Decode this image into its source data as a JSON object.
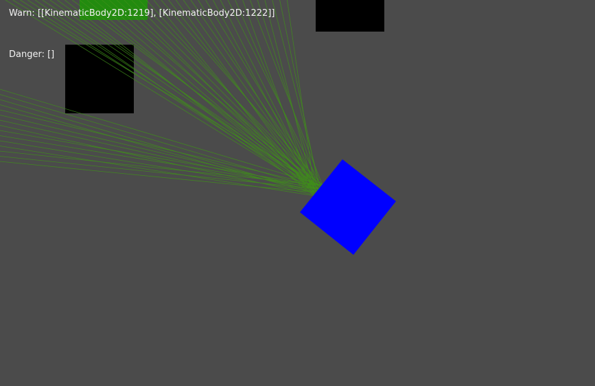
{
  "hud": {
    "warn_text": "Warn: [[KinematicBody2D:1219], [KinematicBody2D:1222]]",
    "danger_text": "Danger: []"
  },
  "colors": {
    "background": "#4b4b4b",
    "obstacle": "#000000",
    "detected_obstacle": "#228b0f",
    "player": "#0000ff",
    "ray": "#3f8f1a",
    "hud_text": "#f2f2f2"
  }
}
